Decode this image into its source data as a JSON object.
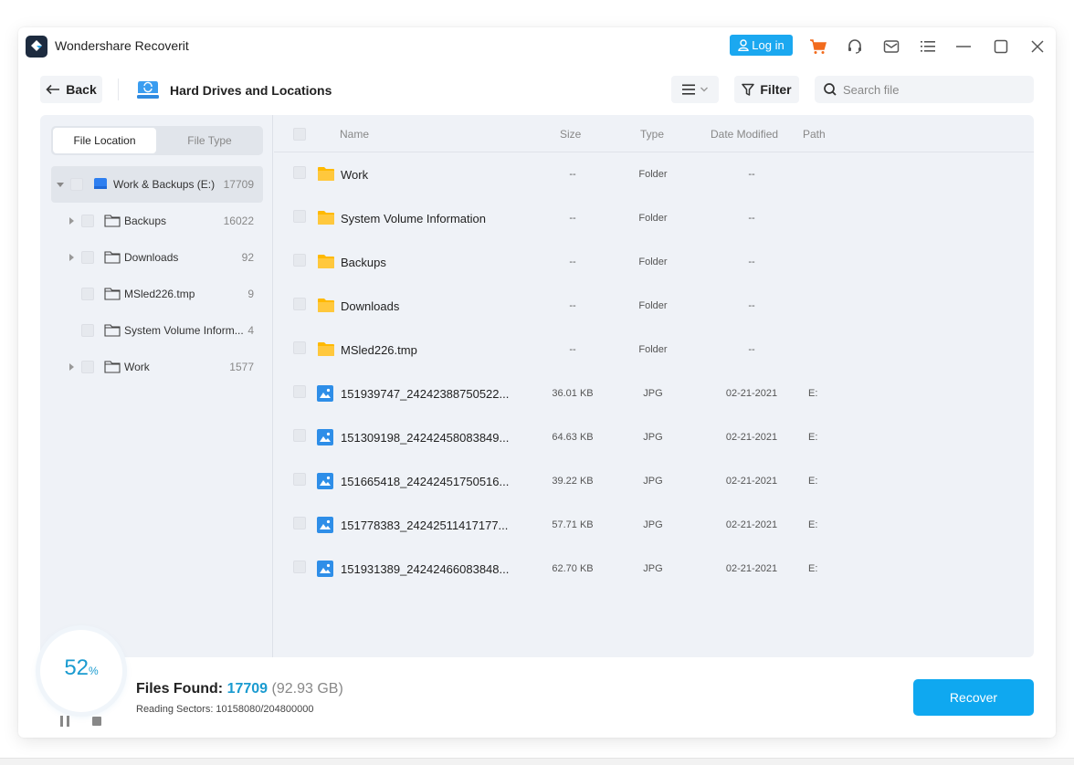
{
  "window": {
    "app_title": "Wondershare Recoverit",
    "login_label": "Log in",
    "icons": [
      "user-icon",
      "cart-icon",
      "headset-icon",
      "mail-icon",
      "menu-list-icon",
      "minimize-icon",
      "maximize-icon",
      "close-icon"
    ]
  },
  "toolbar": {
    "back_label": "Back",
    "location_title": "Hard Drives and Locations",
    "filter_label": "Filter",
    "search_placeholder": "Search file"
  },
  "sidebar": {
    "tabs": [
      {
        "label": "File Location",
        "active": true
      },
      {
        "label": "File Type",
        "active": false
      }
    ],
    "root": {
      "label": "Work & Backups (E:)",
      "count": "17709",
      "expanded": true
    },
    "items": [
      {
        "label": "Backups",
        "count": "16022",
        "expandable": true
      },
      {
        "label": "Downloads",
        "count": "92",
        "expandable": true
      },
      {
        "label": "MSled226.tmp",
        "count": "9",
        "expandable": false
      },
      {
        "label": "System Volume Inform...",
        "count": "4",
        "expandable": false
      },
      {
        "label": "Work",
        "count": "1577",
        "expandable": true
      }
    ]
  },
  "filelist": {
    "headers": {
      "name": "Name",
      "size": "Size",
      "type": "Type",
      "date": "Date Modified",
      "path": "Path"
    },
    "rows": [
      {
        "name": "Work",
        "size": "--",
        "type": "Folder",
        "date": "--",
        "path": "",
        "icon": "folder"
      },
      {
        "name": "System Volume Information",
        "size": "--",
        "type": "Folder",
        "date": "--",
        "path": "",
        "icon": "folder"
      },
      {
        "name": "Backups",
        "size": "--",
        "type": "Folder",
        "date": "--",
        "path": "",
        "icon": "folder"
      },
      {
        "name": "Downloads",
        "size": "--",
        "type": "Folder",
        "date": "--",
        "path": "",
        "icon": "folder"
      },
      {
        "name": "MSled226.tmp",
        "size": "--",
        "type": "Folder",
        "date": "--",
        "path": "",
        "icon": "folder"
      },
      {
        "name": "151939747_24242388750522...",
        "size": "36.01 KB",
        "type": "JPG",
        "date": "02-21-2021",
        "path": "E:",
        "icon": "image"
      },
      {
        "name": "151309198_24242458083849...",
        "size": "64.63 KB",
        "type": "JPG",
        "date": "02-21-2021",
        "path": "E:",
        "icon": "image"
      },
      {
        "name": "151665418_24242451750516...",
        "size": "39.22 KB",
        "type": "JPG",
        "date": "02-21-2021",
        "path": "E:",
        "icon": "image"
      },
      {
        "name": "151778383_24242511417177...",
        "size": "57.71 KB",
        "type": "JPG",
        "date": "02-21-2021",
        "path": "E:",
        "icon": "image"
      },
      {
        "name": "151931389_24242466083848...",
        "size": "62.70 KB",
        "type": "JPG",
        "date": "02-21-2021",
        "path": "E:",
        "icon": "image"
      }
    ]
  },
  "footer": {
    "progress_value": "52",
    "progress_unit": "%",
    "files_found_label": "Files Found:",
    "files_found_count": "17709",
    "files_found_size": "(92.93 GB)",
    "reading_sectors": "Reading Sectors: 10158080/204800000",
    "recover_label": "Recover"
  },
  "colors": {
    "accent": "#1ba8f0",
    "progress_text": "#1a9bd0",
    "folder": "#ffb900",
    "cart": "#f26b1d"
  }
}
